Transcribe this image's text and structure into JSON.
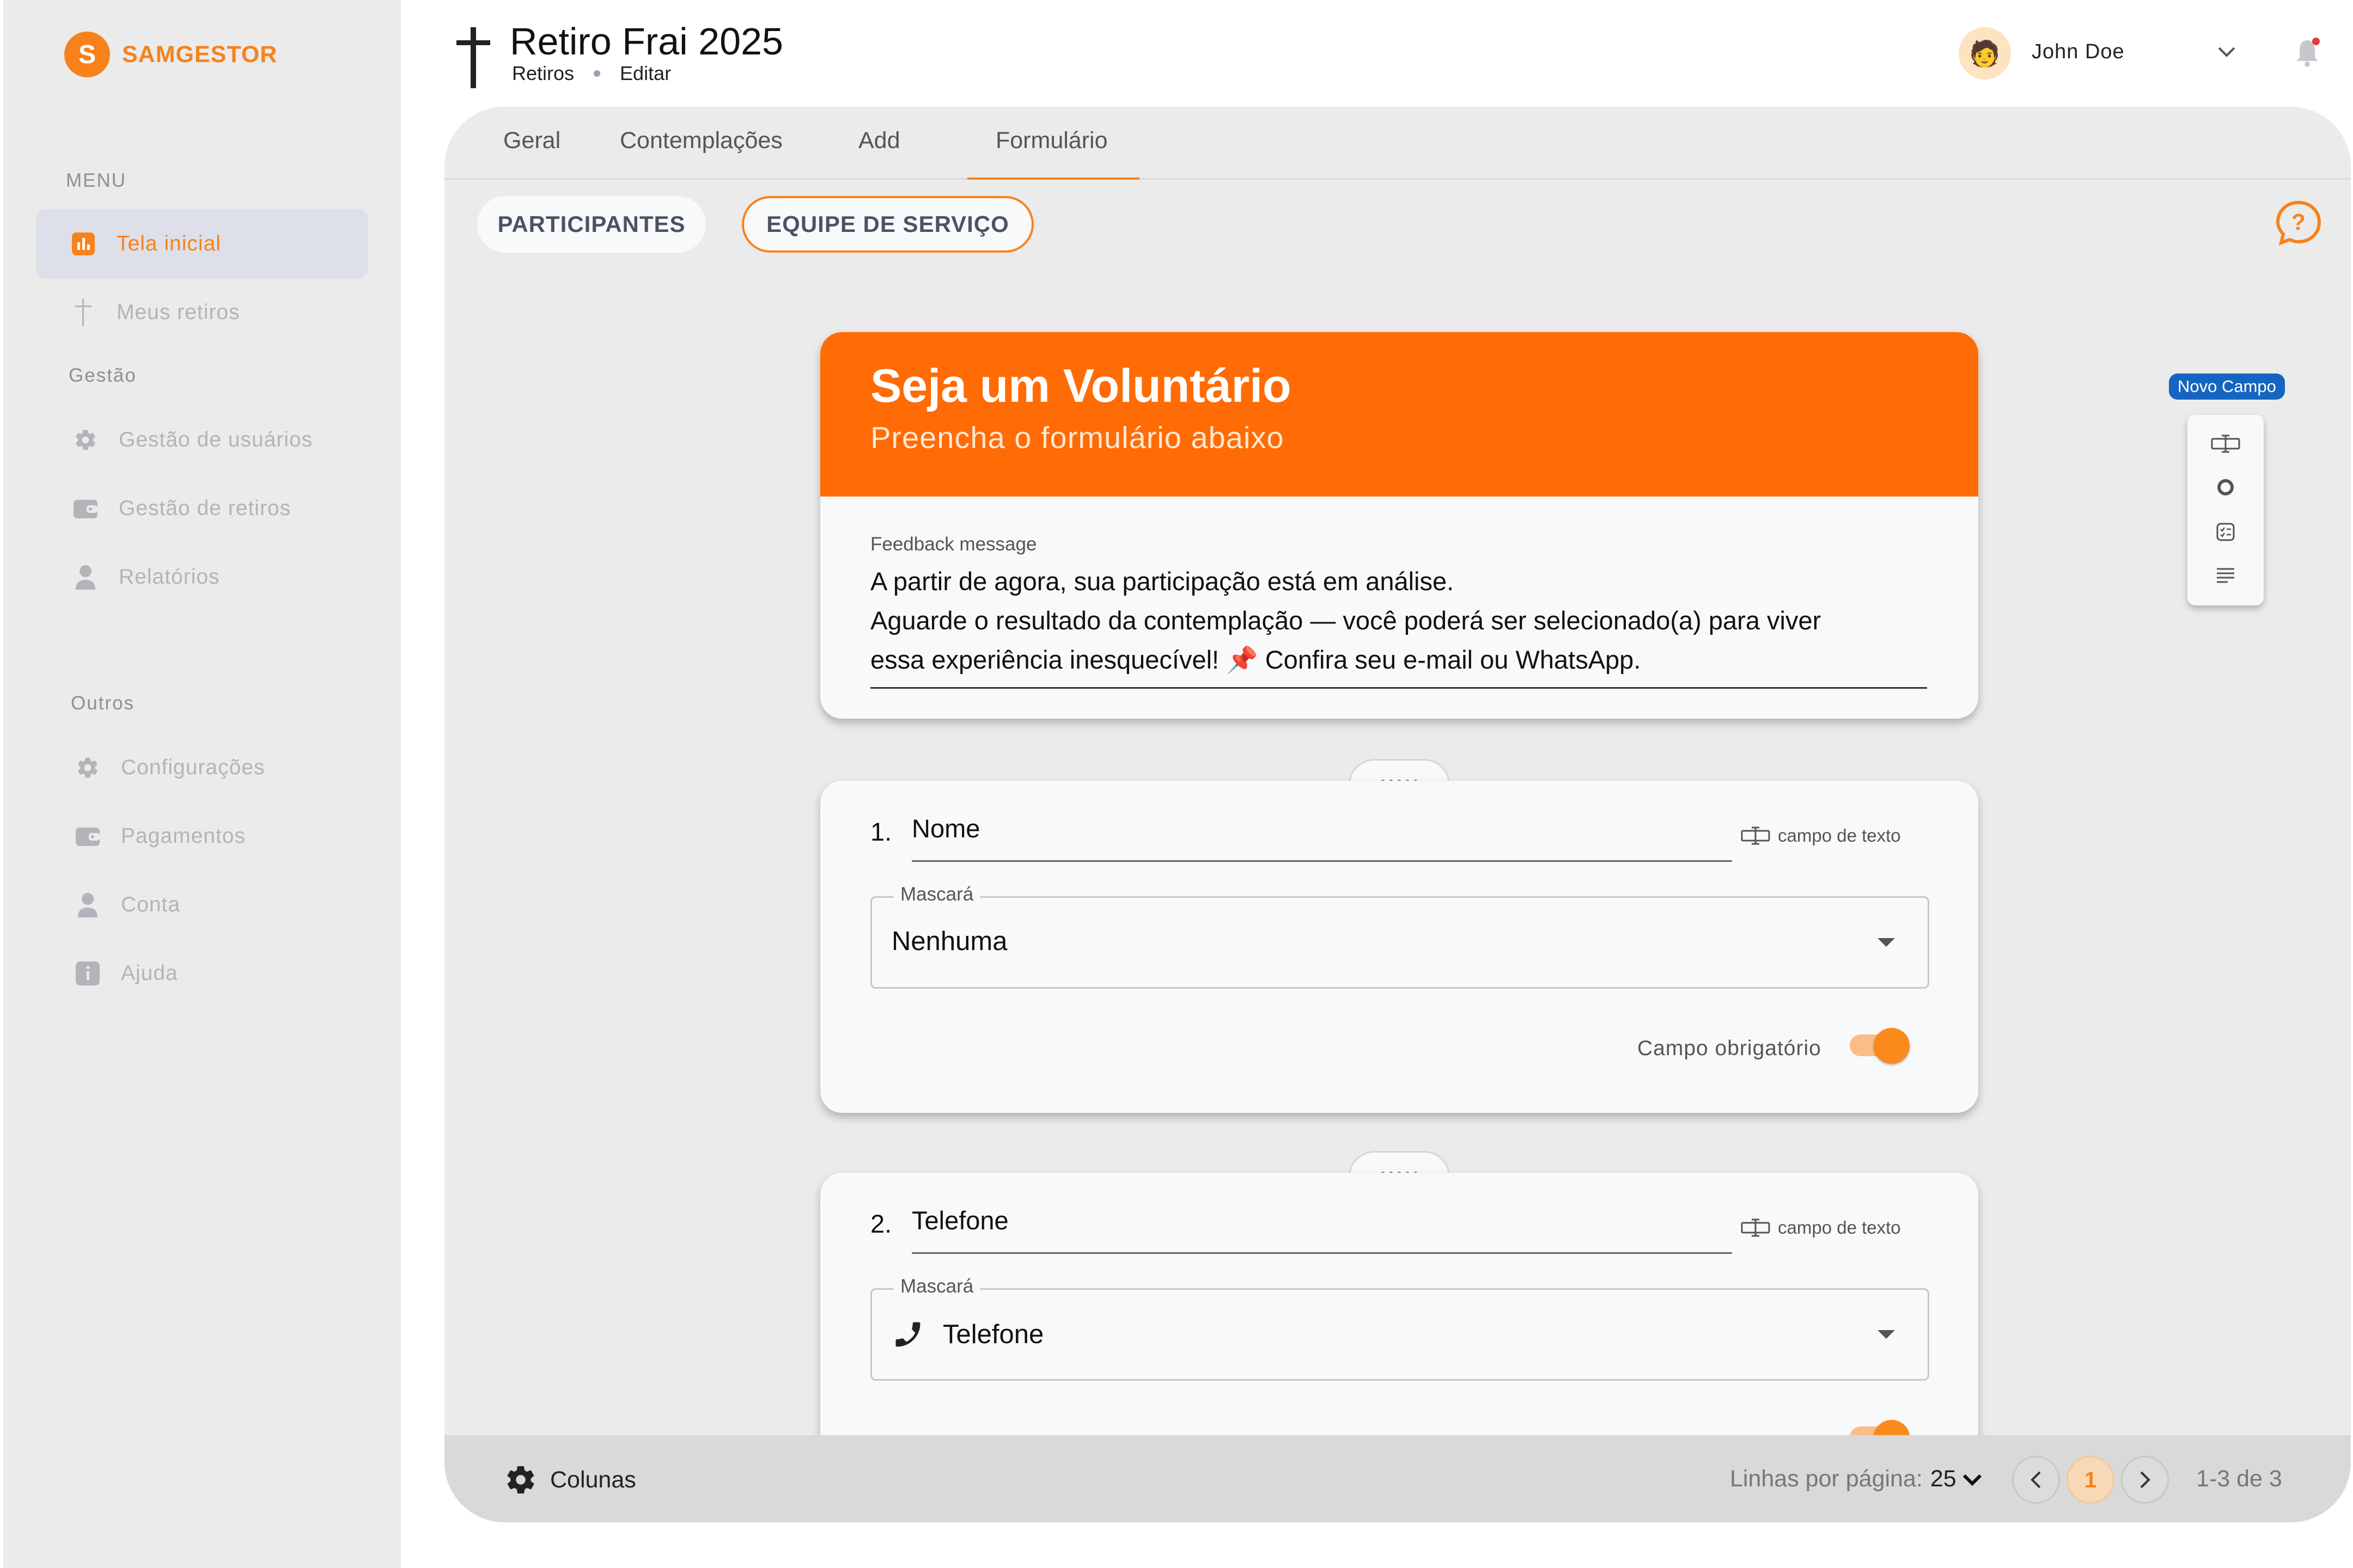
{
  "colors": {
    "accent": "#f7821b",
    "header_orange": "#ff6b04",
    "novo_badge": "#1565c0"
  },
  "brand": {
    "initial": "S",
    "name": "SAMGESTOR"
  },
  "sidebar": {
    "menu_label": "MENU",
    "gestao_label": "Gestão",
    "outros_label": "Outros",
    "items": [
      {
        "label": "Tela inicial",
        "icon": "chart-icon",
        "active": true
      },
      {
        "label": "Meus retiros",
        "icon": "cross-icon"
      },
      {
        "label": "Gestão de usuários",
        "icon": "gear-icon"
      },
      {
        "label": "Gestão de retiros",
        "icon": "wallet-icon"
      },
      {
        "label": "Relatórios",
        "icon": "person-icon"
      },
      {
        "label": "Configurações",
        "icon": "gear-icon"
      },
      {
        "label": "Pagamentos",
        "icon": "wallet-icon"
      },
      {
        "label": "Conta",
        "icon": "person-icon"
      },
      {
        "label": "Ajuda",
        "icon": "info-icon"
      }
    ]
  },
  "header": {
    "title": "Retiro Frai 2025",
    "breadcrumb": [
      "Retiros",
      "Editar"
    ],
    "user": {
      "name": "John Doe",
      "avatar": "🧑"
    }
  },
  "tabs": [
    "Geral",
    "Contemplações",
    "Add",
    "Formulário"
  ],
  "active_tab": "Formulário",
  "pills": {
    "participants": "PARTICIPANTES",
    "service_team": "EQUIPE DE SERVIÇO"
  },
  "form": {
    "title": "Seja um Voluntário",
    "subtitle": "Preencha o formulário abaixo",
    "feedback_label": "Feedback message",
    "feedback_lines": [
      "A partir de agora, sua participação está em análise.",
      "Aguarde o resultado da contemplação — você poderá ser selecionado(a) para viver",
      "essa experiência inesquecível! 📌 Confira seu e-mail ou WhatsApp."
    ],
    "questions": [
      {
        "number": "1.",
        "name": "Nome",
        "type": "campo de texto",
        "mask_label": "Mascará",
        "mask_value": "Nenhuma",
        "required_label": "Campo obrigatório",
        "required": true
      },
      {
        "number": "2.",
        "name": "Telefone",
        "type": "campo de texto",
        "mask_label": "Mascará",
        "mask_value": "Telefone",
        "mask_icon": "phone-icon",
        "required": true
      }
    ]
  },
  "palette": {
    "badge": "Novo Campo",
    "items": [
      "text-field-icon",
      "radio-icon",
      "checkbox-list-icon",
      "paragraph-icon"
    ]
  },
  "footer": {
    "columns_label": "Colunas",
    "rows_per_page_label": "Linhas por página:",
    "rows_per_page_value": "25",
    "current_page": "1",
    "range": "1-3 de 3"
  }
}
